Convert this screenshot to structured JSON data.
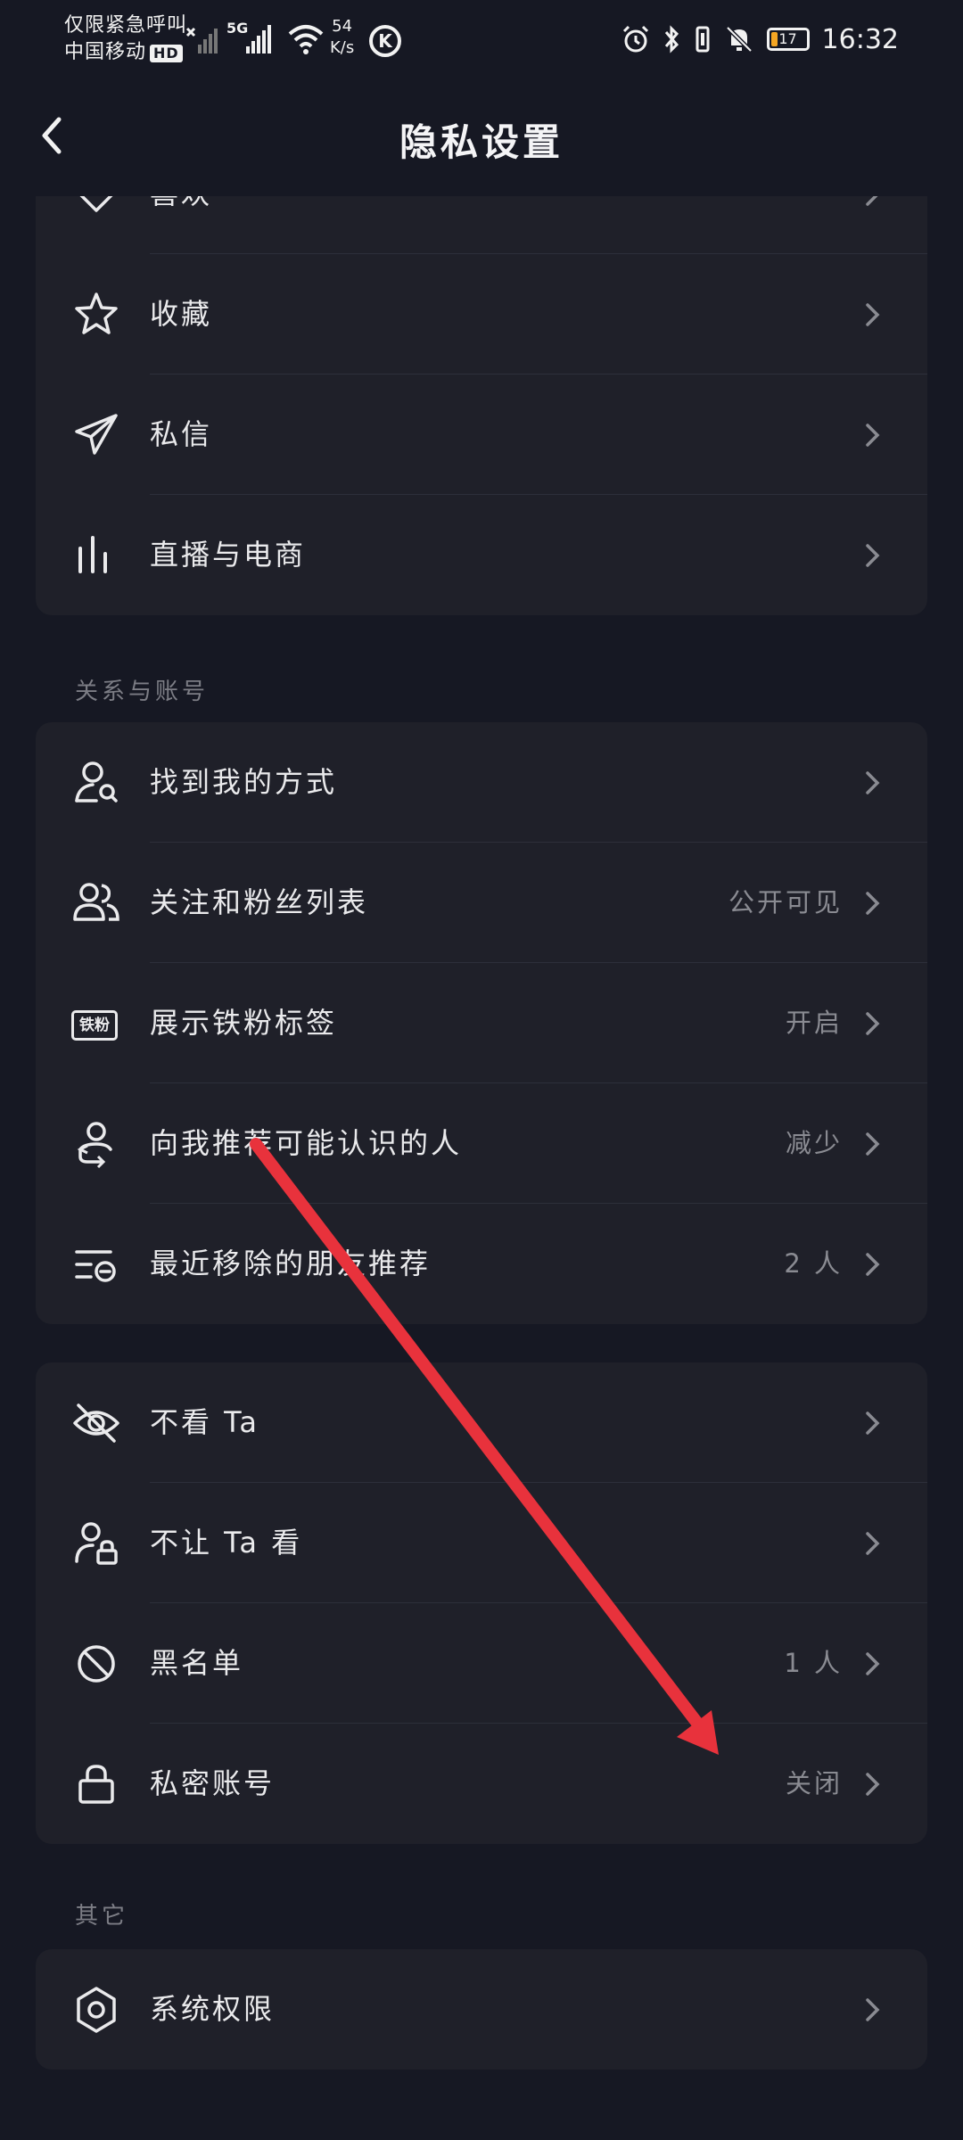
{
  "status_bar": {
    "carrier_line1": "仅限紧急呼叫",
    "carrier_line2": "中国移动",
    "hd": "HD",
    "net_type": "5G",
    "speed_value": "54",
    "speed_unit": "K/s",
    "k_icon": "K",
    "battery": "17",
    "battery_level": 0.17,
    "time": "16:32"
  },
  "header": {
    "title": "隐私设置",
    "back_icon": "chevron-left-icon"
  },
  "section_top": {
    "items": [
      {
        "label": "喜欢",
        "icon": "heart-icon",
        "value": ""
      },
      {
        "label": "收藏",
        "icon": "star-icon",
        "value": ""
      },
      {
        "label": "私信",
        "icon": "send-icon",
        "value": ""
      },
      {
        "label": "直播与电商",
        "icon": "bars-icon",
        "value": ""
      }
    ]
  },
  "section_relations": {
    "title": "关系与账号",
    "items": [
      {
        "label": "找到我的方式",
        "icon": "user-search-icon",
        "value": ""
      },
      {
        "label": "关注和粉丝列表",
        "icon": "users-icon",
        "value": "公开可见"
      },
      {
        "label": "展示铁粉标签",
        "icon": "tiefen-badge-icon",
        "icon_text": "铁粉",
        "value": "开启"
      },
      {
        "label": "向我推荐可能认识的人",
        "icon": "user-recommend-icon",
        "value": "减少"
      },
      {
        "label": "最近移除的朋友推荐",
        "icon": "list-remove-icon",
        "value": "2 人"
      }
    ]
  },
  "section_visibility": {
    "items": [
      {
        "label": "不看 Ta",
        "icon": "eye-off-icon",
        "value": ""
      },
      {
        "label": "不让 Ta 看",
        "icon": "user-lock-icon",
        "value": ""
      },
      {
        "label": "黑名单",
        "icon": "block-icon",
        "value": "1 人"
      },
      {
        "label": "私密账号",
        "icon": "lock-icon",
        "value": "关闭"
      }
    ]
  },
  "section_other": {
    "title": "其它",
    "items": [
      {
        "label": "系统权限",
        "icon": "hexagon-settings-icon",
        "value": ""
      }
    ]
  },
  "colors": {
    "background": "#161823",
    "card": "#1f2029",
    "annotation_arrow": "#e8323c"
  }
}
